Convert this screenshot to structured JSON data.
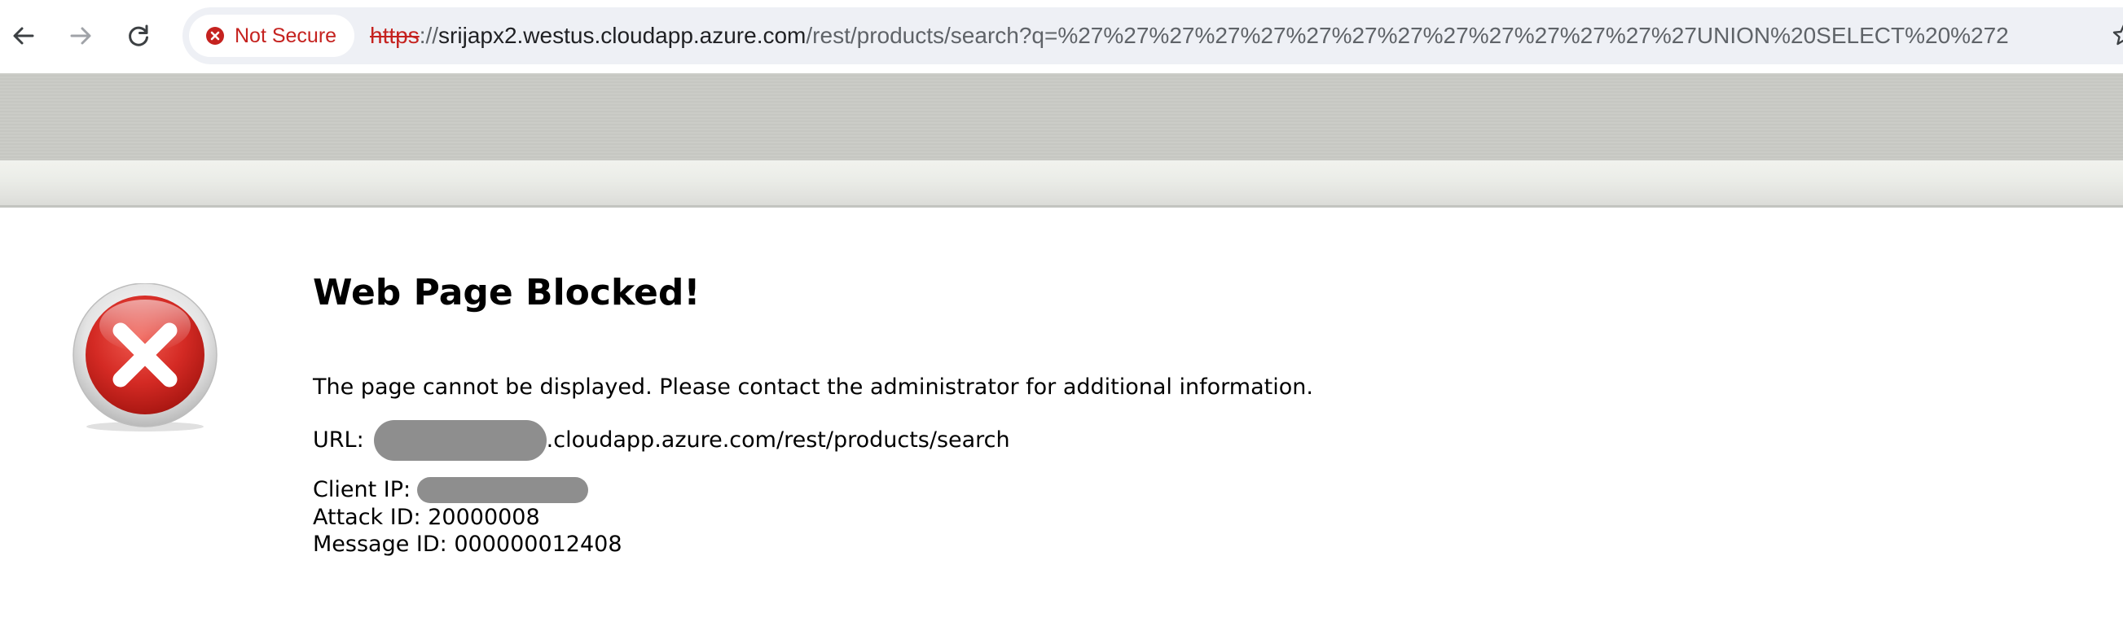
{
  "browser": {
    "security_chip_label": "Not Secure",
    "url_scheme": "https",
    "url_separator": "://",
    "url_host": "srijapx2.westus.cloudapp.azure.com",
    "url_path": "/rest/products/search?q=%27%27%27%27%27%27%27%27%27%27%27%27%27%27UNION%20SELECT%20%272",
    "icons": {
      "back": "arrow-left-icon",
      "forward": "arrow-right-icon",
      "reload": "reload-icon",
      "security": "warning-circle-icon",
      "bookmark": "star-icon"
    },
    "colors": {
      "not_secure": "#c5221f",
      "omnibox_bg": "#eef0f5"
    }
  },
  "block_page": {
    "title": "Web Page Blocked!",
    "message": "The page cannot be displayed. Please contact the administrator for additional information.",
    "url_label": "URL:",
    "url_value": ".cloudapp.azure.com/rest/products/search",
    "client_ip_label": "Client IP:",
    "attack_id_label": "Attack ID:",
    "attack_id_value": "20000008",
    "message_id_label": "Message ID:",
    "message_id_value": "000000012408",
    "icon": "error-x-icon",
    "colors": {
      "error_red": "#d42a24",
      "redaction_gray": "#8e8e8e"
    }
  }
}
